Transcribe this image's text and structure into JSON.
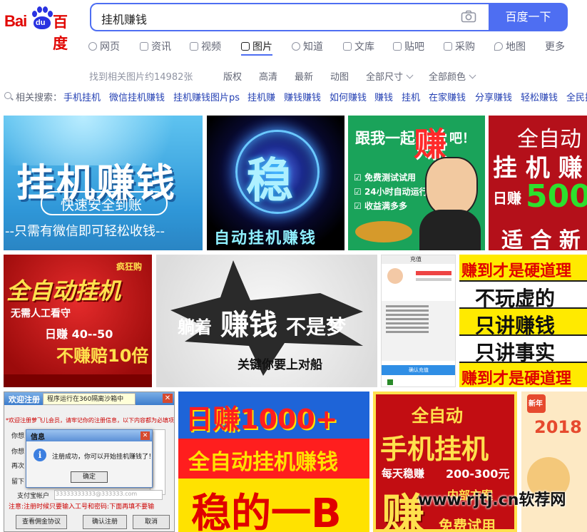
{
  "logo": {
    "latin": "Bai",
    "paw_text": "du",
    "cn": "百度"
  },
  "search": {
    "query": "挂机赚钱",
    "button": "百度一下",
    "camera_icon": "camera-icon"
  },
  "tabs": [
    {
      "label": "网页",
      "icon": "search-icon"
    },
    {
      "label": "资讯",
      "icon": "news-icon"
    },
    {
      "label": "视频",
      "icon": "video-icon"
    },
    {
      "label": "图片",
      "icon": "image-icon",
      "active": true
    },
    {
      "label": "知道",
      "icon": "question-icon"
    },
    {
      "label": "文库",
      "icon": "doc-icon"
    },
    {
      "label": "贴吧",
      "icon": "tieba-icon"
    },
    {
      "label": "采购",
      "icon": "cart-icon"
    },
    {
      "label": "地图",
      "icon": "map-icon"
    },
    {
      "label": "更多",
      "icon": ""
    }
  ],
  "filters": {
    "count": "找到相关图片约14982张",
    "items": [
      "版权",
      "高清",
      "最新",
      "动图",
      "全部尺寸",
      "全部颜色"
    ]
  },
  "related": {
    "label": "相关搜索：",
    "items": [
      "手机挂机",
      "微信挂机赚钱",
      "挂机赚钱图片ps",
      "挂机赚",
      "赚钱赚钱",
      "如何赚钱",
      "赚钱",
      "挂机",
      "在家赚钱",
      "分享赚钱",
      "轻松赚钱",
      "全民挂"
    ]
  },
  "images": {
    "i1": {
      "title": "挂机赚钱",
      "sub": "快速安全到账",
      "line": "--只需有微信即可轻松收钱--"
    },
    "i2": {
      "big": "稳",
      "line": "自动挂机赚钱"
    },
    "i3": {
      "title": "跟我一起来",
      "hl": "赚",
      "end": "吧！",
      "b1": "免费测试试用",
      "b2": "24小时自动运行",
      "b3": "收益满多多"
    },
    "i4": {
      "l1": "全自动",
      "l2": "挂 机 赚",
      "l3a": "日赚",
      "l3b": "500",
      "l4": "适 合 新"
    },
    "i5": {
      "tag": "疯狂购",
      "title": "全自动挂机",
      "l1": "无需人工看守",
      "l2": "日赚 40--50",
      "l3": "不赚赔10倍"
    },
    "i6": {
      "a": "躺着",
      "b": "赚钱",
      "c": "不是梦",
      "d": "关键你要上对船"
    },
    "i7": {
      "head": "充值",
      "btn": "确认充值"
    },
    "i8": {
      "l1": "赚到才是硬道理",
      "l2": "不玩虚的",
      "l3": "只讲赚钱",
      "l4": "只讲事实",
      "l5": "赚到才是硬道理"
    },
    "i9": {
      "title": "欢迎注册",
      "tip": "程序运行在360隔离沙箱中",
      "notice": "*欢迎注册萝飞儿会员，请牢记你的注册信息，以下内容都为必填项",
      "f1": "你想",
      "f2": "你想",
      "f3": "再次",
      "f4": "留下",
      "f5": "支付宝帐户",
      "mask": "33333333333@333333.com",
      "warn": "注意:注册时候只要输入工号和密码:下面再填不要输",
      "dlg_title": "信息",
      "dlg_msg": "注册成功，你可以开始挂机赚钱了！",
      "dlg_ok": "确定",
      "b1": "查看佣金协议",
      "b2": "确认注册",
      "b3": "取消"
    },
    "i10": {
      "l1": "日赚1000+",
      "l2": "全自动挂机赚钱",
      "l3": "稳的一B"
    },
    "i11": {
      "l1": "全自动",
      "l2": "手机挂机",
      "l3": "每天稳赚",
      "l4": "200-300元",
      "l5": "内部方案",
      "l6": "免费试用",
      "big": "赚"
    },
    "i12": {
      "tag": "新年",
      "year": "2018"
    }
  },
  "watermark": "www.rjtj.cn软荐网"
}
